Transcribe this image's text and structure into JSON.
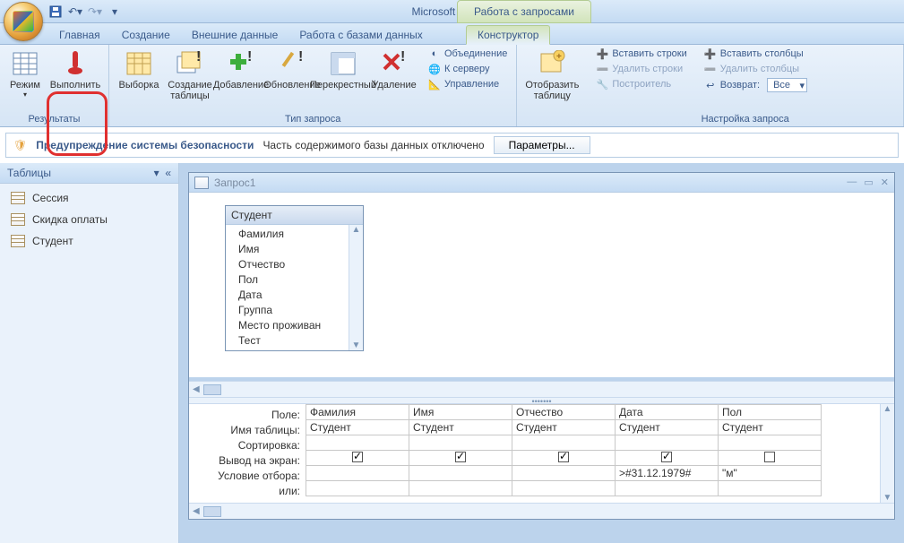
{
  "app_title": "Microsoft Access",
  "context_tab_group": "Работа с запросами",
  "tabs": {
    "home": "Главная",
    "create": "Создание",
    "external": "Внешние данные",
    "dbtools": "Работа с базами данных",
    "designer": "Конструктор"
  },
  "ribbon": {
    "results": {
      "mode": "Режим",
      "run": "Выполнить",
      "label": "Результаты"
    },
    "query_type": {
      "select": "Выборка",
      "make_table": "Создание таблицы",
      "append": "Добавление",
      "update": "Обновление",
      "crosstab": "Перекрестный",
      "delete": "Удаление",
      "union": "Объединение",
      "passthrough": "К серверу",
      "datadef": "Управление",
      "label": "Тип запроса"
    },
    "show_table": {
      "btn": "Отобразить таблицу"
    },
    "setup": {
      "insert_rows": "Вставить строки",
      "delete_rows": "Удалить строки",
      "builder": "Построитель",
      "insert_cols": "Вставить столбцы",
      "delete_cols": "Удалить столбцы",
      "return": "Возврат:",
      "return_value": "Все",
      "label": "Настройка запроса"
    }
  },
  "security": {
    "title": "Предупреждение системы безопасности",
    "msg": "Часть содержимого базы данных отключено",
    "btn": "Параметры..."
  },
  "nav": {
    "header": "Таблицы",
    "items": [
      "Сессия",
      "Скидка оплаты",
      "Студент"
    ]
  },
  "query_window": {
    "title": "Запрос1",
    "source_table": {
      "name": "Студент",
      "fields": [
        "Фамилия",
        "Имя",
        "Отчество",
        "Пол",
        "Дата",
        "Группа",
        "Место проживан",
        "Тест"
      ]
    },
    "design_grid": {
      "row_labels": [
        "Поле:",
        "Имя таблицы:",
        "Сортировка:",
        "Вывод на экран:",
        "Условие отбора:",
        "или:"
      ],
      "columns": [
        {
          "field": "Фамилия",
          "table": "Студент",
          "sort": "",
          "show": true,
          "criteria": "",
          "or": ""
        },
        {
          "field": "Имя",
          "table": "Студент",
          "sort": "",
          "show": true,
          "criteria": "",
          "or": ""
        },
        {
          "field": "Отчество",
          "table": "Студент",
          "sort": "",
          "show": true,
          "criteria": "",
          "or": ""
        },
        {
          "field": "Дата",
          "table": "Студент",
          "sort": "",
          "show": true,
          "criteria": ">#31.12.1979#",
          "or": ""
        },
        {
          "field": "Пол",
          "table": "Студент",
          "sort": "",
          "show": false,
          "criteria": "\"м\"",
          "or": ""
        }
      ]
    }
  }
}
